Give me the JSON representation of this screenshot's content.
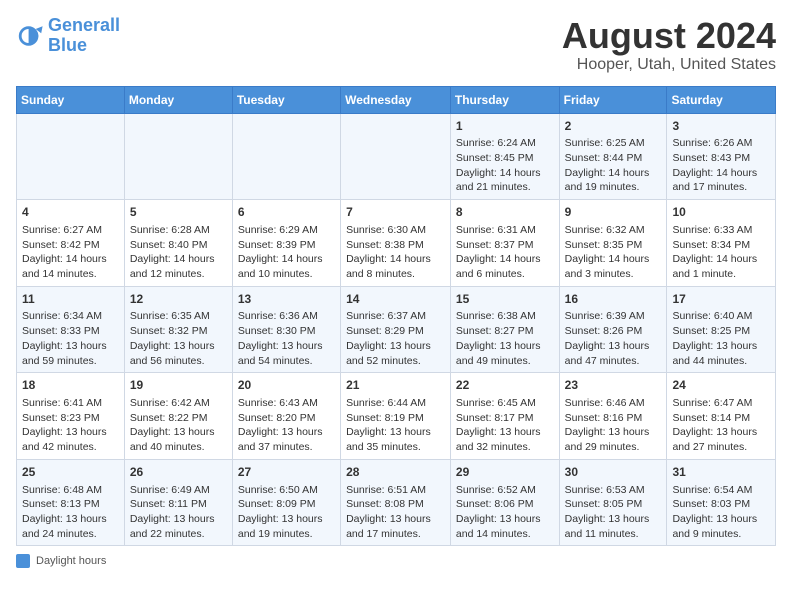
{
  "header": {
    "logo_line1": "General",
    "logo_line2": "Blue",
    "month_year": "August 2024",
    "location": "Hooper, Utah, United States"
  },
  "days_of_week": [
    "Sunday",
    "Monday",
    "Tuesday",
    "Wednesday",
    "Thursday",
    "Friday",
    "Saturday"
  ],
  "weeks": [
    [
      {
        "day": "",
        "info": ""
      },
      {
        "day": "",
        "info": ""
      },
      {
        "day": "",
        "info": ""
      },
      {
        "day": "",
        "info": ""
      },
      {
        "day": "1",
        "info": "Sunrise: 6:24 AM\nSunset: 8:45 PM\nDaylight: 14 hours and 21 minutes."
      },
      {
        "day": "2",
        "info": "Sunrise: 6:25 AM\nSunset: 8:44 PM\nDaylight: 14 hours and 19 minutes."
      },
      {
        "day": "3",
        "info": "Sunrise: 6:26 AM\nSunset: 8:43 PM\nDaylight: 14 hours and 17 minutes."
      }
    ],
    [
      {
        "day": "4",
        "info": "Sunrise: 6:27 AM\nSunset: 8:42 PM\nDaylight: 14 hours and 14 minutes."
      },
      {
        "day": "5",
        "info": "Sunrise: 6:28 AM\nSunset: 8:40 PM\nDaylight: 14 hours and 12 minutes."
      },
      {
        "day": "6",
        "info": "Sunrise: 6:29 AM\nSunset: 8:39 PM\nDaylight: 14 hours and 10 minutes."
      },
      {
        "day": "7",
        "info": "Sunrise: 6:30 AM\nSunset: 8:38 PM\nDaylight: 14 hours and 8 minutes."
      },
      {
        "day": "8",
        "info": "Sunrise: 6:31 AM\nSunset: 8:37 PM\nDaylight: 14 hours and 6 minutes."
      },
      {
        "day": "9",
        "info": "Sunrise: 6:32 AM\nSunset: 8:35 PM\nDaylight: 14 hours and 3 minutes."
      },
      {
        "day": "10",
        "info": "Sunrise: 6:33 AM\nSunset: 8:34 PM\nDaylight: 14 hours and 1 minute."
      }
    ],
    [
      {
        "day": "11",
        "info": "Sunrise: 6:34 AM\nSunset: 8:33 PM\nDaylight: 13 hours and 59 minutes."
      },
      {
        "day": "12",
        "info": "Sunrise: 6:35 AM\nSunset: 8:32 PM\nDaylight: 13 hours and 56 minutes."
      },
      {
        "day": "13",
        "info": "Sunrise: 6:36 AM\nSunset: 8:30 PM\nDaylight: 13 hours and 54 minutes."
      },
      {
        "day": "14",
        "info": "Sunrise: 6:37 AM\nSunset: 8:29 PM\nDaylight: 13 hours and 52 minutes."
      },
      {
        "day": "15",
        "info": "Sunrise: 6:38 AM\nSunset: 8:27 PM\nDaylight: 13 hours and 49 minutes."
      },
      {
        "day": "16",
        "info": "Sunrise: 6:39 AM\nSunset: 8:26 PM\nDaylight: 13 hours and 47 minutes."
      },
      {
        "day": "17",
        "info": "Sunrise: 6:40 AM\nSunset: 8:25 PM\nDaylight: 13 hours and 44 minutes."
      }
    ],
    [
      {
        "day": "18",
        "info": "Sunrise: 6:41 AM\nSunset: 8:23 PM\nDaylight: 13 hours and 42 minutes."
      },
      {
        "day": "19",
        "info": "Sunrise: 6:42 AM\nSunset: 8:22 PM\nDaylight: 13 hours and 40 minutes."
      },
      {
        "day": "20",
        "info": "Sunrise: 6:43 AM\nSunset: 8:20 PM\nDaylight: 13 hours and 37 minutes."
      },
      {
        "day": "21",
        "info": "Sunrise: 6:44 AM\nSunset: 8:19 PM\nDaylight: 13 hours and 35 minutes."
      },
      {
        "day": "22",
        "info": "Sunrise: 6:45 AM\nSunset: 8:17 PM\nDaylight: 13 hours and 32 minutes."
      },
      {
        "day": "23",
        "info": "Sunrise: 6:46 AM\nSunset: 8:16 PM\nDaylight: 13 hours and 29 minutes."
      },
      {
        "day": "24",
        "info": "Sunrise: 6:47 AM\nSunset: 8:14 PM\nDaylight: 13 hours and 27 minutes."
      }
    ],
    [
      {
        "day": "25",
        "info": "Sunrise: 6:48 AM\nSunset: 8:13 PM\nDaylight: 13 hours and 24 minutes."
      },
      {
        "day": "26",
        "info": "Sunrise: 6:49 AM\nSunset: 8:11 PM\nDaylight: 13 hours and 22 minutes."
      },
      {
        "day": "27",
        "info": "Sunrise: 6:50 AM\nSunset: 8:09 PM\nDaylight: 13 hours and 19 minutes."
      },
      {
        "day": "28",
        "info": "Sunrise: 6:51 AM\nSunset: 8:08 PM\nDaylight: 13 hours and 17 minutes."
      },
      {
        "day": "29",
        "info": "Sunrise: 6:52 AM\nSunset: 8:06 PM\nDaylight: 13 hours and 14 minutes."
      },
      {
        "day": "30",
        "info": "Sunrise: 6:53 AM\nSunset: 8:05 PM\nDaylight: 13 hours and 11 minutes."
      },
      {
        "day": "31",
        "info": "Sunrise: 6:54 AM\nSunset: 8:03 PM\nDaylight: 13 hours and 9 minutes."
      }
    ]
  ],
  "footer": {
    "legend_label": "Daylight hours"
  }
}
